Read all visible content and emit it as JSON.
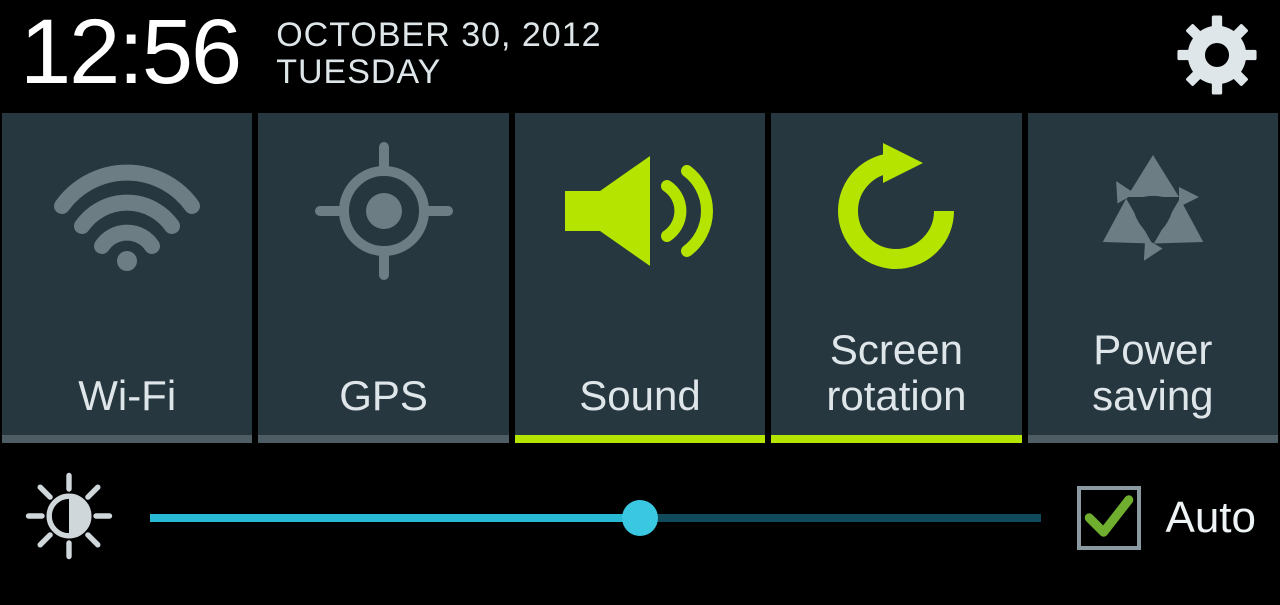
{
  "header": {
    "time": "12:56",
    "date": "OCTOBER 30, 2012",
    "day": "TUESDAY"
  },
  "colors": {
    "active": "#b4e400",
    "inactive": "#6c7d84",
    "panel": "#263740",
    "sliderFill": "#28b9d4",
    "sliderTrack": "#0f4b5a"
  },
  "toggles": [
    {
      "id": "wifi",
      "label": "Wi-Fi",
      "icon": "wifi-icon",
      "active": false
    },
    {
      "id": "gps",
      "label": "GPS",
      "icon": "gps-icon",
      "active": false
    },
    {
      "id": "sound",
      "label": "Sound",
      "icon": "sound-icon",
      "active": true
    },
    {
      "id": "rotation",
      "label": "Screen\nrotation",
      "icon": "rotation-icon",
      "active": true
    },
    {
      "id": "power",
      "label": "Power\nsaving",
      "icon": "recycle-icon",
      "active": false
    }
  ],
  "brightness": {
    "percent": 55,
    "auto_label": "Auto",
    "auto_checked": true
  }
}
